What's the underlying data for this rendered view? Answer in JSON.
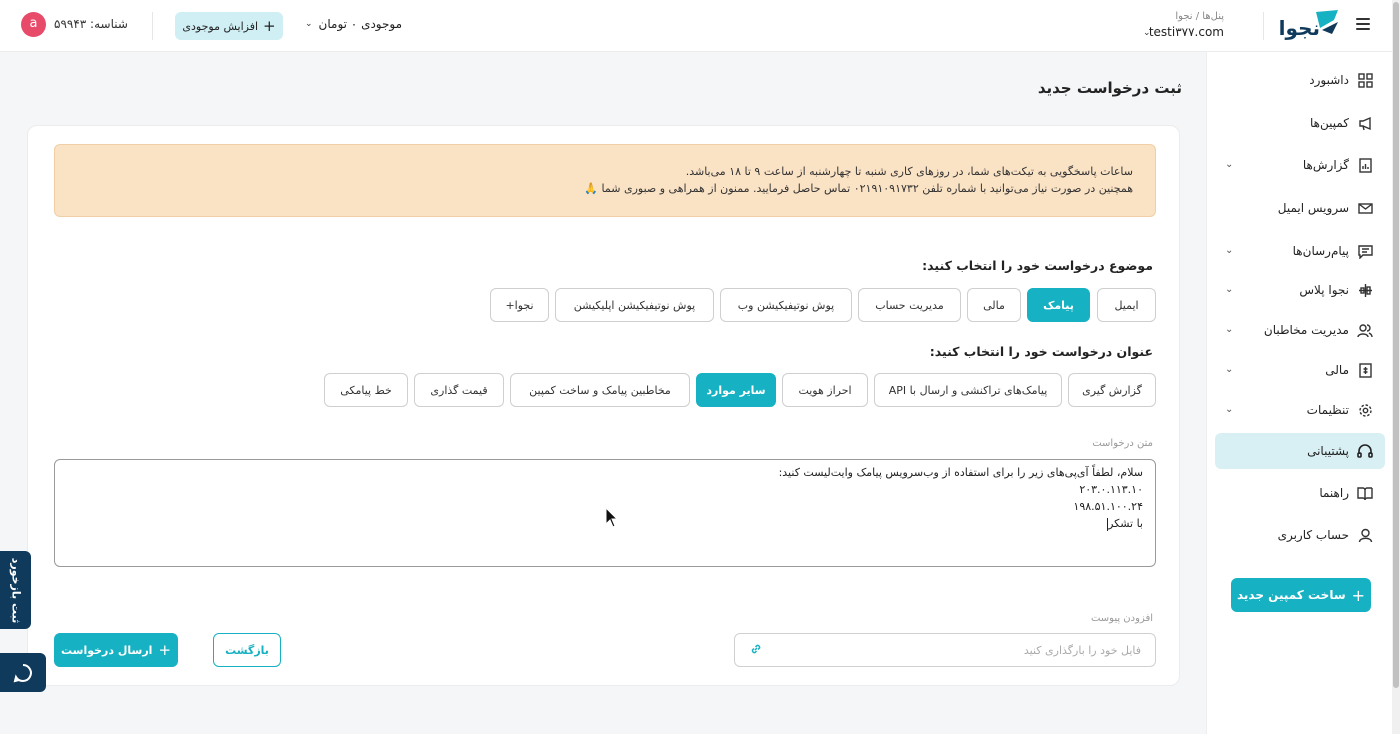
{
  "header": {
    "brand": "نجوا",
    "panel_breadcrumb": "پنل‌ها / نجوا",
    "panel_account": "testi۳۷۷.com",
    "balance_label": "موجودی ۰ تومان",
    "increase_balance_label": "افزایش موجودی",
    "user_id_label": "شناسه: ۵۹۹۴۳",
    "avatar_initial": "a"
  },
  "sidebar": {
    "items": [
      {
        "label": "داشبورد",
        "icon": "dashboard-icon",
        "has_chevron": false
      },
      {
        "label": "کمپین‌ها",
        "icon": "megaphone-icon",
        "has_chevron": false
      },
      {
        "label": "گزارش‌ها",
        "icon": "report-icon",
        "has_chevron": true
      },
      {
        "label": "سرویس ایمیل",
        "icon": "mail-icon",
        "has_chevron": false
      },
      {
        "label": "پیام‌رسان‌ها",
        "icon": "message-icon",
        "has_chevron": true
      },
      {
        "label": "نجوا پلاس",
        "icon": "plus-tools-icon",
        "has_chevron": true
      },
      {
        "label": "مدیریت مخاطبان",
        "icon": "users-icon",
        "has_chevron": true
      },
      {
        "label": "مالی",
        "icon": "finance-icon",
        "has_chevron": true
      },
      {
        "label": "تنظیمات",
        "icon": "gear-icon",
        "has_chevron": true
      },
      {
        "label": "پشتیبانی",
        "icon": "headset-icon",
        "has_chevron": false,
        "active": true
      },
      {
        "label": "راهنما",
        "icon": "book-icon",
        "has_chevron": false
      },
      {
        "label": "حساب کاربری",
        "icon": "user-icon",
        "has_chevron": false
      }
    ],
    "new_campaign_label": "ساخت کمپین جدید"
  },
  "main": {
    "title": "ثبت درخواست جدید",
    "notice_line1": "ساعات پاسخگویی به تیکت‌های شما، در روزهای کاری شنبه تا چهارشنبه از ساعت ۹ تا ۱۸ می‌باشد.",
    "notice_line2": "همچنین در صورت نیاز می‌توانید با شماره تلفن ۰۲۱۹۱۰۹۱۷۳۲ تماس حاصل فرمایید. ممنون از همراهی و صبوری شما 🙏",
    "subject_label": "موضوع درخواست خود را انتخاب کنید:",
    "subjects": [
      "ایمیل",
      "پیامک",
      "مالی",
      "مدیریت حساب",
      "پوش نوتیفیکیشن وب",
      "پوش نوتیفیکیشن اپلیکیشن",
      "نجوا+"
    ],
    "subject_selected": "پیامک",
    "title_label": "عنوان درخواست خود را انتخاب کنید:",
    "titles": [
      "گزارش گیری",
      "پیامک‌های تراکنشی و ارسال با API",
      "احراز هویت",
      "سایر موارد",
      "مخاطبین پیامک و ساخت کمپین",
      "قیمت گذاری",
      "خط پیامکی"
    ],
    "title_selected": "سایر موارد",
    "text_label": "متن درخواست",
    "text_lines": [
      "سلام، لطفاً آی‌پی‌های زیر را برای استفاده از وب‌سرویس پیامک وایت‌لیست کنید:",
      "۲۰۳.۰.۱۱۳.۱۰",
      "۱۹۸.۵۱.۱۰۰.۲۴",
      "با تشکر"
    ],
    "attachment_label": "افزودن پیوست",
    "attachment_placeholder": "فایل خود را بارگذاری کنید",
    "back_label": "بازگشت",
    "send_label": "ارسال درخواست"
  },
  "floating": {
    "feedback_label": "ثبت بازخورد",
    "chat_icon": "chat-icon"
  },
  "colors": {
    "accent": "#16b1c2",
    "brand_dark": "#0f3a5c",
    "notice_bg": "#fae2c4",
    "avatar": "#e84a6a"
  }
}
